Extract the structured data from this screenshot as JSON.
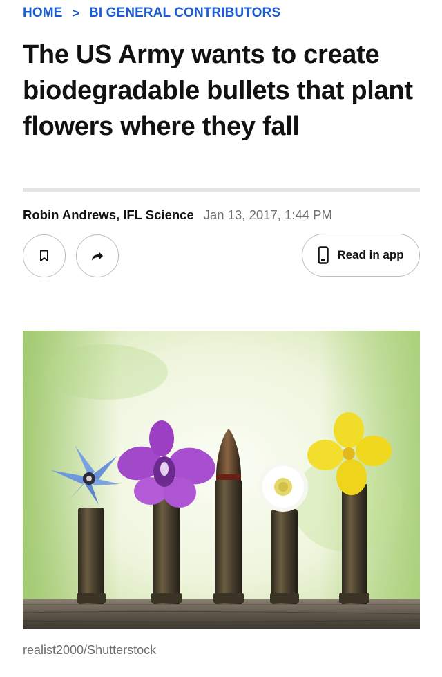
{
  "breadcrumb": {
    "home": "HOME",
    "separator": ">",
    "section": "BI GENERAL CONTRIBUTORS"
  },
  "article": {
    "headline": "The US Army wants to create biodegradable bullets that plant flowers where they fall",
    "author": "Robin Andrews, IFL Science",
    "date": "Jan 13, 2017, 1:44 PM"
  },
  "actions": {
    "save_icon": "bookmark-icon",
    "share_icon": "share-arrow-icon",
    "read_in_app_label": "Read in app",
    "read_in_app_icon": "phone-icon"
  },
  "image": {
    "credit": "realist2000/Shutterstock"
  },
  "colors": {
    "link_blue": "#1a5bd6",
    "text": "#111111",
    "muted": "#6f6f6f",
    "border": "#bdbdbd"
  }
}
